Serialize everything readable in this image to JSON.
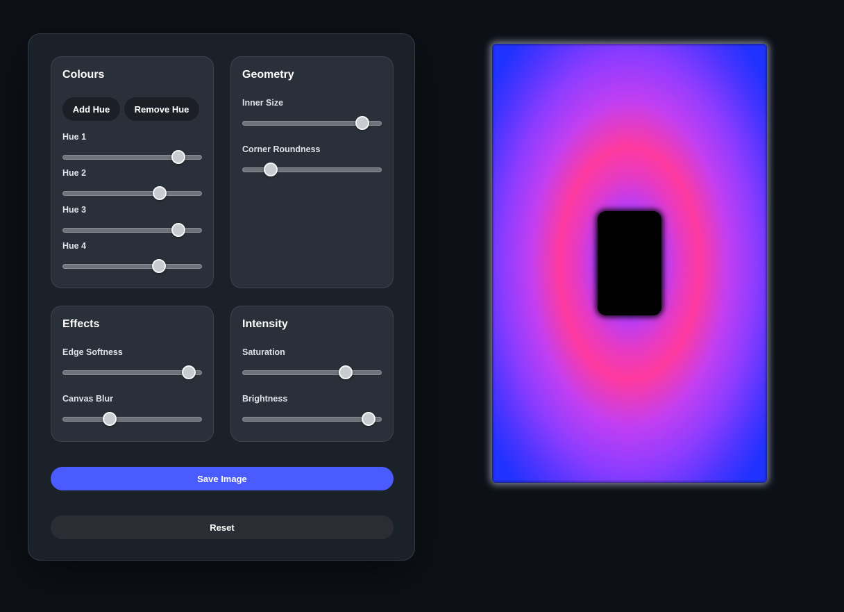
{
  "colours": {
    "title": "Colours",
    "add_hue_label": "Add Hue",
    "remove_hue_label": "Remove Hue",
    "hues": [
      {
        "label": "Hue 1",
        "value": 0.87
      },
      {
        "label": "Hue 2",
        "value": 0.72
      },
      {
        "label": "Hue 3",
        "value": 0.87
      },
      {
        "label": "Hue 4",
        "value": 0.71
      }
    ]
  },
  "geometry": {
    "title": "Geometry",
    "inner_size": {
      "label": "Inner Size",
      "value": 0.9
    },
    "corner_roundness": {
      "label": "Corner Roundness",
      "value": 0.17
    }
  },
  "effects": {
    "title": "Effects",
    "edge_softness": {
      "label": "Edge Softness",
      "value": 0.95
    },
    "canvas_blur": {
      "label": "Canvas Blur",
      "value": 0.32
    }
  },
  "intensity": {
    "title": "Intensity",
    "saturation": {
      "label": "Saturation",
      "value": 0.77
    },
    "brightness": {
      "label": "Brightness",
      "value": 0.95
    }
  },
  "actions": {
    "save_label": "Save Image",
    "reset_label": "Reset"
  },
  "colors": {
    "accent": "#4a5cff",
    "background": "#0d1117",
    "preview_outer": "#1f32ff",
    "preview_ring": "#ff3a9e",
    "preview_inner": "#b23dff"
  }
}
